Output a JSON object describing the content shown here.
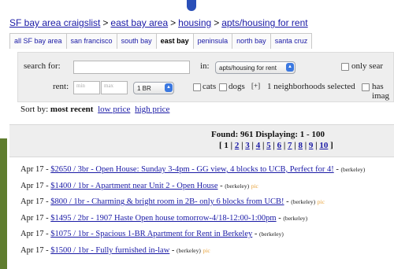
{
  "breadcrumb": {
    "items": [
      "SF bay area craigslist",
      "east bay area",
      "housing",
      "apts/housing for rent"
    ],
    "separator": ">"
  },
  "tabs": [
    {
      "label": "all SF bay area",
      "active": false
    },
    {
      "label": "san francisco",
      "active": false
    },
    {
      "label": "south bay",
      "active": false
    },
    {
      "label": "east bay",
      "active": true
    },
    {
      "label": "peninsula",
      "active": false
    },
    {
      "label": "north bay",
      "active": false
    },
    {
      "label": "santa cruz",
      "active": false
    }
  ],
  "search": {
    "search_label": "search for:",
    "search_value": "",
    "in_label": "in:",
    "category_value": "apts/housing for rent",
    "only_search_label": "only sear",
    "rent_label": "rent:",
    "min_placeholder": "min",
    "max_placeholder": "max",
    "bedrooms_value": "1 BR",
    "cats_label": "cats",
    "dogs_label": "dogs",
    "plus": "[+]",
    "neighborhoods_text": "1 neighborhoods selected",
    "has_image_label": "has imag"
  },
  "sort": {
    "prefix": "Sort by:",
    "current": "most recent",
    "options": [
      "low price",
      "high price"
    ]
  },
  "results": {
    "found_text": "Found: 961 Displaying: 1 - 100",
    "pages": [
      "1",
      "2",
      "3",
      "4",
      "5",
      "6",
      "7",
      "8",
      "9",
      "10"
    ],
    "open_bracket": "[",
    "close_bracket": "]",
    "divider": "|"
  },
  "listings": [
    {
      "date": "Apr 17",
      "title": "$2650 / 3br - Open House: Sunday 3-4pm - GG view, 4 blocks to UCB, Perfect for 4!",
      "location": "(berkeley)",
      "pic": ""
    },
    {
      "date": "Apr 17",
      "title": "$1400 / 1br - Apartment near Unit 2 - Open House",
      "location": "(berkeley)",
      "pic": "pic"
    },
    {
      "date": "Apr 17",
      "title": "$800 / 1br - Charming & bright room in 2B- only 6 blocks from UCB!",
      "location": "(berkeley)",
      "pic": "pic"
    },
    {
      "date": "Apr 17",
      "title": "$1495 / 2br - 1907 Haste Open house tomorrow-4/18-12:00-1:00pm",
      "location": "(berkeley)",
      "pic": ""
    },
    {
      "date": "Apr 17",
      "title": "$1075 / 1br - Spacious 1-BR Apartment for Rent in Berkeley",
      "location": "(berkeley)",
      "pic": ""
    },
    {
      "date": "Apr 17",
      "title": "$1500 / 1br - Fully furnished in-law",
      "location": "(berkeley)",
      "pic": "pic"
    }
  ],
  "colors": {
    "link": "#1a1aa6",
    "panel": "#eeeeee",
    "pic": "#e7a23a",
    "stripe": "#5f7d2e",
    "dot": "#2a4fb8"
  }
}
